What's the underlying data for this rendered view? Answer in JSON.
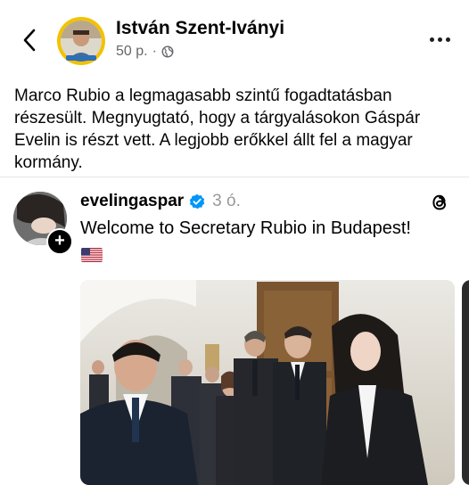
{
  "header": {
    "author_name": "István Szent-Iványi",
    "time": "50 p.",
    "separator": "·",
    "back_icon": "chevron-left-icon",
    "privacy_icon": "globe-icon",
    "more_icon": "more-horizontal-icon"
  },
  "post": {
    "text": "Marco Rubio a legmagasabb szintű fogadtatásban részesült. Megnyugtató, hogy a tárgyalásokon Gáspár Evelin is részt vett. A legjobb erőkkel állt fel a magyar kormány."
  },
  "embed": {
    "username": "evelingaspar",
    "time": "3 ó.",
    "text": "Welcome to Secretary Rubio in Budapest!",
    "verified_color": "#0095f6",
    "platform_icon": "threads-icon",
    "flag_icon": "us-flag-icon"
  }
}
